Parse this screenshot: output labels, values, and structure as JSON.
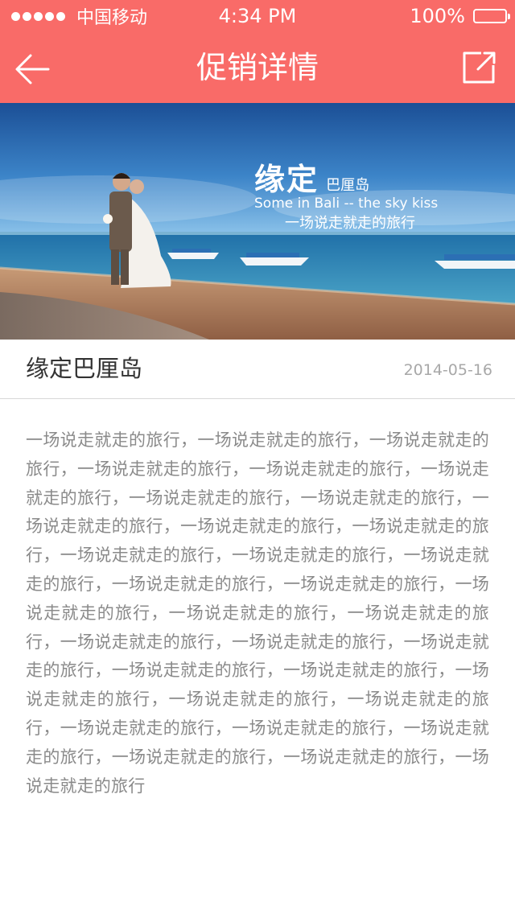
{
  "status_bar": {
    "carrier": "中国移动",
    "time": "4:34 PM",
    "battery": "100%"
  },
  "nav": {
    "title": "促销详情",
    "back_icon": "back-arrow-icon",
    "share_icon": "share-icon"
  },
  "banner": {
    "headline": "缘定",
    "location": "巴厘岛",
    "tagline_en": "Some in Bali -- the sky kiss",
    "tagline_cn": "一场说走就走的旅行"
  },
  "post": {
    "title": "缘定巴厘岛",
    "date": "2014-05-16",
    "body": "一场说走就走的旅行，一场说走就走的旅行，一场说走就走的旅行，一场说走就走的旅行，一场说走就走的旅行，一场说走就走的旅行，一场说走就走的旅行，一场说走就走的旅行，一场说走就走的旅行，一场说走就走的旅行，一场说走就走的旅行，一场说走就走的旅行，一场说走就走的旅行，一场说走就走的旅行，一场说走就走的旅行，一场说走就走的旅行，一场说走就走的旅行，一场说走就走的旅行，一场说走就走的旅行，一场说走就走的旅行，一场说走就走的旅行，一场说走就走的旅行，一场说走就走的旅行，一场说走就走的旅行，一场说走就走的旅行，一场说走就走的旅行，一场说走就走的旅行，一场说走就走的旅行，一场说走就走的旅行，一场说走就走的旅行，一场说走就走的旅行，一场说走就走的旅行，一场说走就走的旅行"
  },
  "colors": {
    "accent": "#f96b68",
    "title_text": "#333333",
    "body_text": "#8a8a8a",
    "date_text": "#a8a8a8"
  }
}
